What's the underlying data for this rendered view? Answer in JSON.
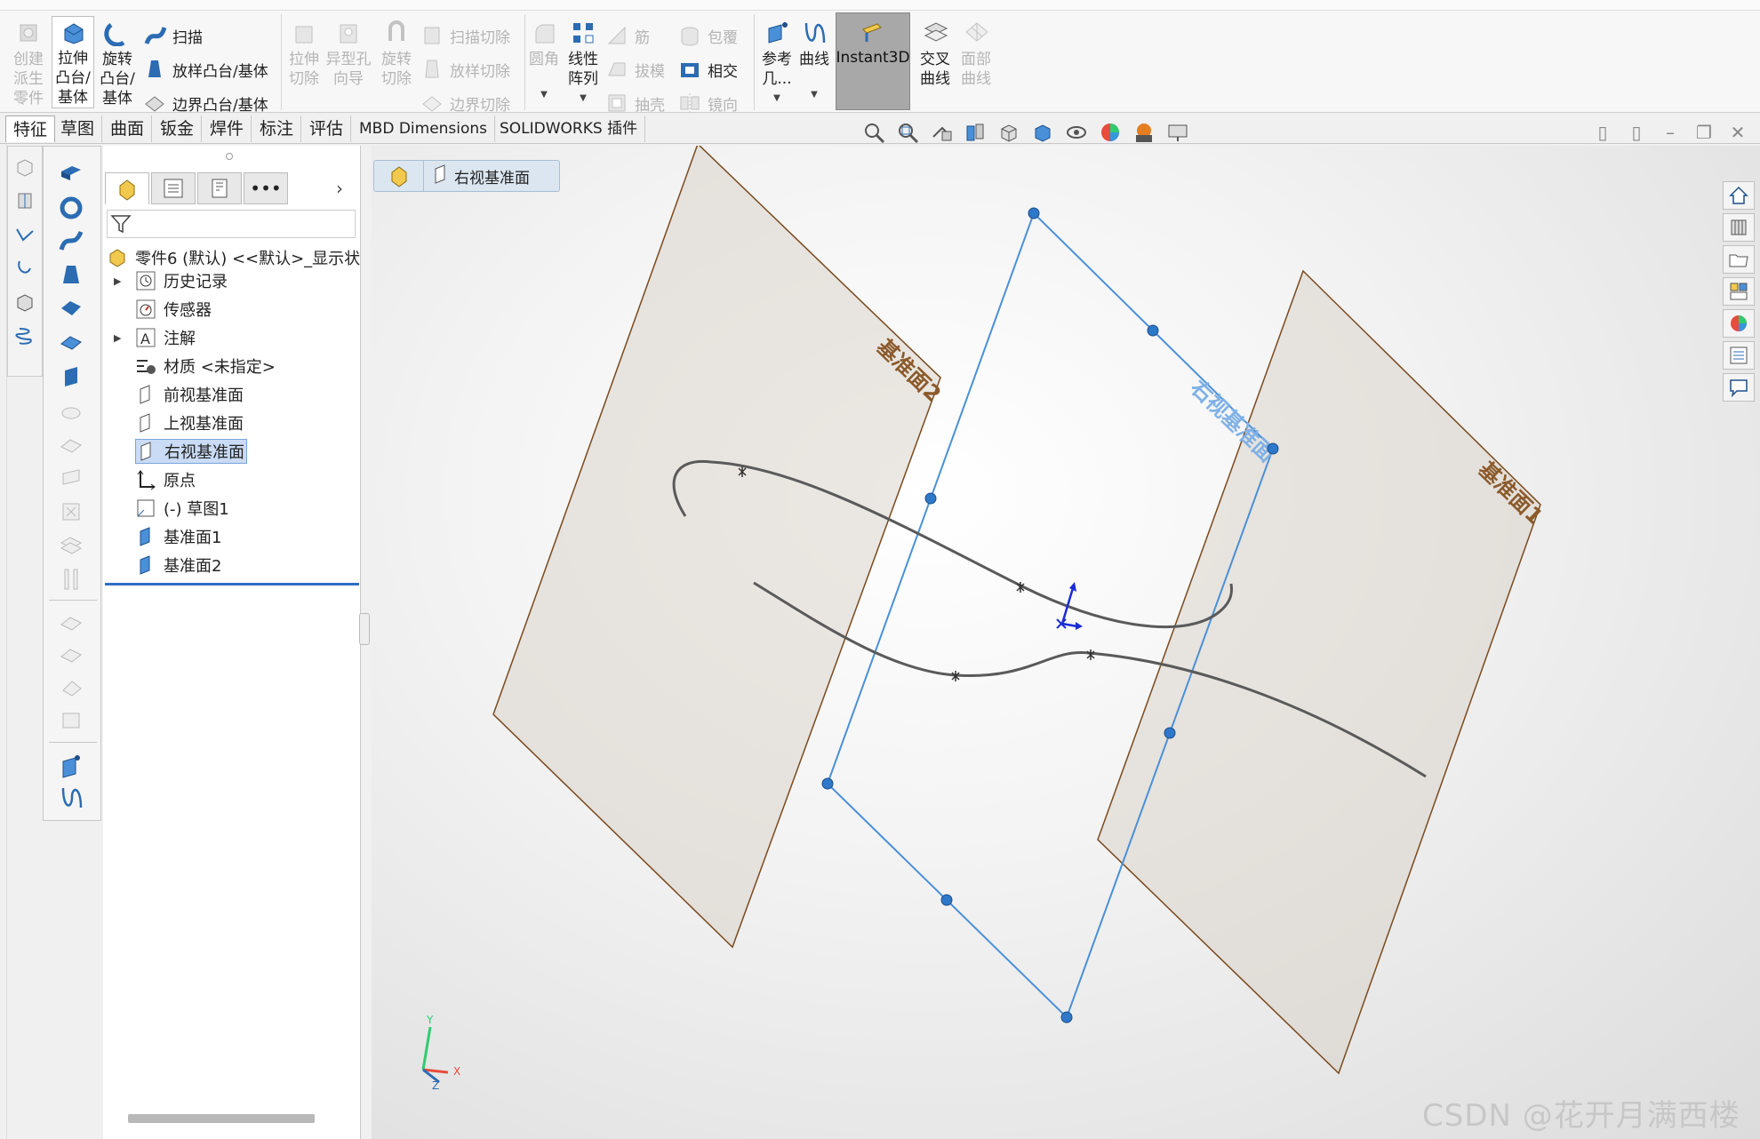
{
  "ribbon": {
    "create_derived": "创建\n派生\n零件",
    "extrude_boss": "拉伸\n凸台/\n基体",
    "revolve_boss": "旋转\n凸台/\n基体",
    "sweep": "扫描",
    "loft_boss": "放样凸台/基体",
    "boundary_boss": "边界凸台/基体",
    "extrude_cut": "拉伸\n切除",
    "hole_wizard": "异型孔\n向导",
    "revolve_cut": "旋转\n切除",
    "sweep_cut": "扫描切除",
    "loft_cut": "放样切除",
    "boundary_cut": "边界切除",
    "fillet": "圆角",
    "linear_pattern": "线性\n阵列",
    "rib": "筋",
    "draft": "拔模",
    "shell": "抽壳",
    "wrap": "包覆",
    "intersect": "相交",
    "mirror": "镜向",
    "ref_geometry": "参考\n几...",
    "curves": "曲线",
    "instant3d": "Instant3D",
    "intersection_curve": "交叉\n曲线",
    "face_curves": "面部\n曲线"
  },
  "tabs": [
    {
      "label": "特征"
    },
    {
      "label": "草图"
    },
    {
      "label": "曲面"
    },
    {
      "label": "钣金"
    },
    {
      "label": "焊件"
    },
    {
      "label": "标注"
    },
    {
      "label": "评估"
    },
    {
      "label": "MBD Dimensions"
    },
    {
      "label": "SOLIDWORKS 插件"
    }
  ],
  "tree": {
    "root": "零件6 (默认) <<默认>_显示状",
    "items": [
      {
        "label": "历史记录"
      },
      {
        "label": "传感器"
      },
      {
        "label": "注解"
      },
      {
        "label": "材质 <未指定>"
      },
      {
        "label": "前视基准面"
      },
      {
        "label": "上视基准面"
      },
      {
        "label": "右视基准面"
      },
      {
        "label": "原点"
      },
      {
        "label": "(-) 草图1"
      },
      {
        "label": "基准面1"
      },
      {
        "label": "基准面2"
      }
    ]
  },
  "breadcrumb": {
    "label": "右视基准面"
  },
  "viewport": {
    "plane_left_label": "基准面2",
    "plane_right_label": "基准面1",
    "plane_center_label": "右视基准面",
    "triad_x": "X",
    "triad_y": "Y",
    "triad_z": "Z"
  },
  "colors": {
    "accent": "#2d6fc2",
    "plane_edge": "#7a4a1e",
    "selected_plane": "#4a90d9",
    "instant3d_active": "#a8a8a8"
  },
  "watermark": "CSDN @花开月满西楼"
}
